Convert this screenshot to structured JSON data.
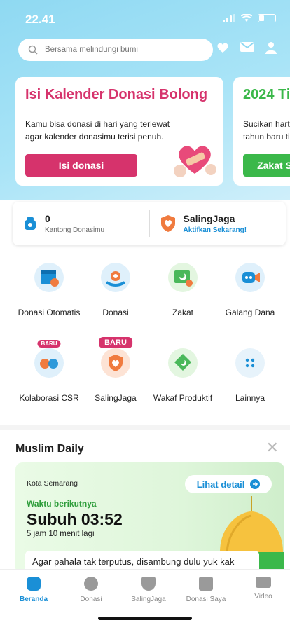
{
  "status": {
    "time": "22.41"
  },
  "search": {
    "placeholder": "Bersama melindungi bumi"
  },
  "header_icons": [
    "heart-hand-icon",
    "mail-icon",
    "profile-icon"
  ],
  "promo_cards": [
    {
      "title": "Isi Kalender Donasi Bolong",
      "body": "Kamu bisa donasi di hari yang terlewat agar kalender donasimu terisi penuh.",
      "button": "Isi donasi",
      "accent": "#d6336c"
    },
    {
      "title": "2024 Ti",
      "body": "Sucikan harta tahun baru ti",
      "button": "Zakat S",
      "accent": "#3bb84a"
    }
  ],
  "wallet": {
    "amount": "0",
    "label": "Kantong Donasimu",
    "jaga_title": "SalingJaga",
    "jaga_link": "Aktifkan Sekarang!"
  },
  "menu": [
    {
      "label": "Donasi Otomatis",
      "icon": "calendar-heart-icon",
      "badge": ""
    },
    {
      "label": "Donasi",
      "icon": "donation-hand-icon",
      "badge": ""
    },
    {
      "label": "Zakat",
      "icon": "zakat-icon",
      "badge": ""
    },
    {
      "label": "Galang Dana",
      "icon": "fundraise-megaphone-icon",
      "badge": ""
    },
    {
      "label": "Kolaborasi CSR",
      "icon": "csr-collab-icon",
      "badge": "BARU"
    },
    {
      "label": "SalingJaga",
      "icon": "shield-heart-icon",
      "badge": "BARU"
    },
    {
      "label": "Wakaf Produktif",
      "icon": "wakaf-icon",
      "badge": ""
    },
    {
      "label": "Lainnya",
      "icon": "more-dots-icon",
      "badge": ""
    }
  ],
  "muslim_daily": {
    "title": "Muslim Daily",
    "city": "Kota Semarang",
    "detail_label": "Lihat detail",
    "next_label": "Waktu berikutnya",
    "prayer": "Subuh 03:52",
    "remaining": "5 jam 10 menit lagi",
    "note": "Agar pahala tak terputus, disambung dulu yuk kak"
  },
  "tabs": [
    {
      "label": "Beranda",
      "icon": "home-icon",
      "active": true
    },
    {
      "label": "Donasi",
      "icon": "donasi-icon",
      "active": false
    },
    {
      "label": "SalingJaga",
      "icon": "shield-icon",
      "active": false
    },
    {
      "label": "Donasi Saya",
      "icon": "document-icon",
      "active": false
    },
    {
      "label": "Video",
      "icon": "video-icon",
      "active": false
    }
  ],
  "colors": {
    "primary": "#1a8fd6",
    "pink": "#d6336c",
    "green": "#3bb84a"
  }
}
